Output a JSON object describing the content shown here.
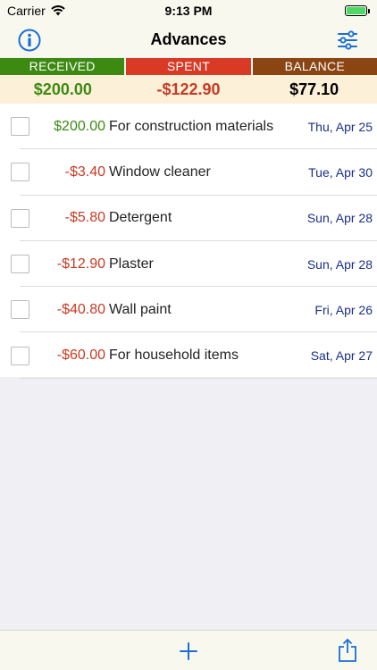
{
  "status_bar": {
    "carrier": "Carrier",
    "time": "9:13 PM",
    "battery_level": 1.0,
    "battery_color": "#4cd964"
  },
  "nav": {
    "title": "Advances",
    "left_icon": "info-icon",
    "right_icon": "filter-sliders-icon",
    "accent_color": "#1a6fd6"
  },
  "summary": {
    "received": {
      "label": "RECEIVED",
      "value": "$200.00",
      "header_color": "#3c8a12",
      "value_color": "#3c8a12"
    },
    "spent": {
      "label": "SPENT",
      "value": "-$122.90",
      "header_color": "#d83a26",
      "value_color": "#c83a24"
    },
    "balance": {
      "label": "BALANCE",
      "value": "$77.10",
      "header_color": "#8b4513",
      "value_color": "#000000"
    }
  },
  "transactions": [
    {
      "amount": "$200.00",
      "type": "income",
      "description": "For construction materials",
      "date": "Thu, Apr 25"
    },
    {
      "amount": "-$3.40",
      "type": "expense",
      "description": "Window cleaner",
      "date": "Tue, Apr 30"
    },
    {
      "amount": "-$5.80",
      "type": "expense",
      "description": "Detergent",
      "date": "Sun, Apr 28"
    },
    {
      "amount": "-$12.90",
      "type": "expense",
      "description": "Plaster",
      "date": "Sun, Apr 28"
    },
    {
      "amount": "-$40.80",
      "type": "expense",
      "description": "Wall paint",
      "date": "Fri, Apr 26"
    },
    {
      "amount": "-$60.00",
      "type": "expense",
      "description": "For household items",
      "date": "Sat, Apr 27"
    }
  ],
  "colors": {
    "income": "#3c8a12",
    "expense": "#c83a24",
    "date": "#1a2f8a"
  },
  "toolbar": {
    "add_icon": "plus-icon",
    "share_icon": "share-icon"
  }
}
